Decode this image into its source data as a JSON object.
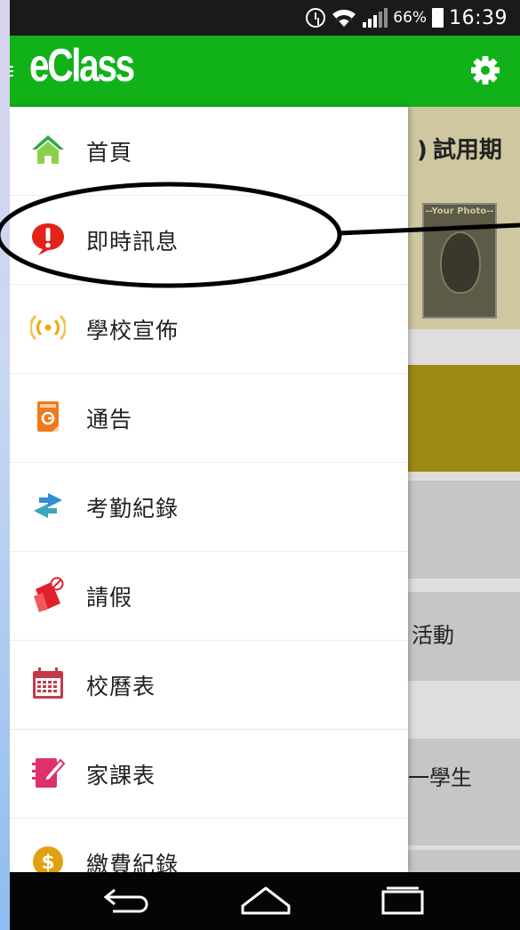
{
  "status_bar": {
    "battery_percent": "66%",
    "time": "16:39",
    "icons": [
      "alarm-icon",
      "wifi-icon",
      "signal-icon",
      "battery-icon"
    ]
  },
  "app_bar": {
    "logo_text": "eClass",
    "settings_icon": "gear-icon",
    "menu_icon": "hamburger-icon"
  },
  "background": {
    "trial_text": "試用期",
    "photo_label": "--Your Photo--",
    "activity_text": "活動",
    "student_text": "一學生"
  },
  "drawer": {
    "items": [
      {
        "label": "首頁",
        "icon": "home-icon",
        "color": "#2aa84a"
      },
      {
        "label": "即時訊息",
        "icon": "message-alert-icon",
        "color": "#e2231a"
      },
      {
        "label": "學校宣佈",
        "icon": "broadcast-icon",
        "color": "#f0a80a"
      },
      {
        "label": "通告",
        "icon": "notice-icon",
        "color": "#f07a1a"
      },
      {
        "label": "考勤紀錄",
        "icon": "attendance-icon",
        "color": "#2f8fd0"
      },
      {
        "label": "請假",
        "icon": "leave-icon",
        "color": "#e0202a"
      },
      {
        "label": "校曆表",
        "icon": "calendar-icon",
        "color": "#c23a4a"
      },
      {
        "label": "家課表",
        "icon": "homework-icon",
        "color": "#e0306a"
      },
      {
        "label": "繳費紀錄",
        "icon": "payment-icon",
        "color": "#e0a010"
      }
    ]
  },
  "nav_bar": {
    "icons": [
      "back-icon",
      "home-nav-icon",
      "recents-icon"
    ]
  },
  "colors": {
    "brand_green": "#11b11a",
    "status_bar": "#1a1a1a",
    "nav_bar": "#050505"
  }
}
